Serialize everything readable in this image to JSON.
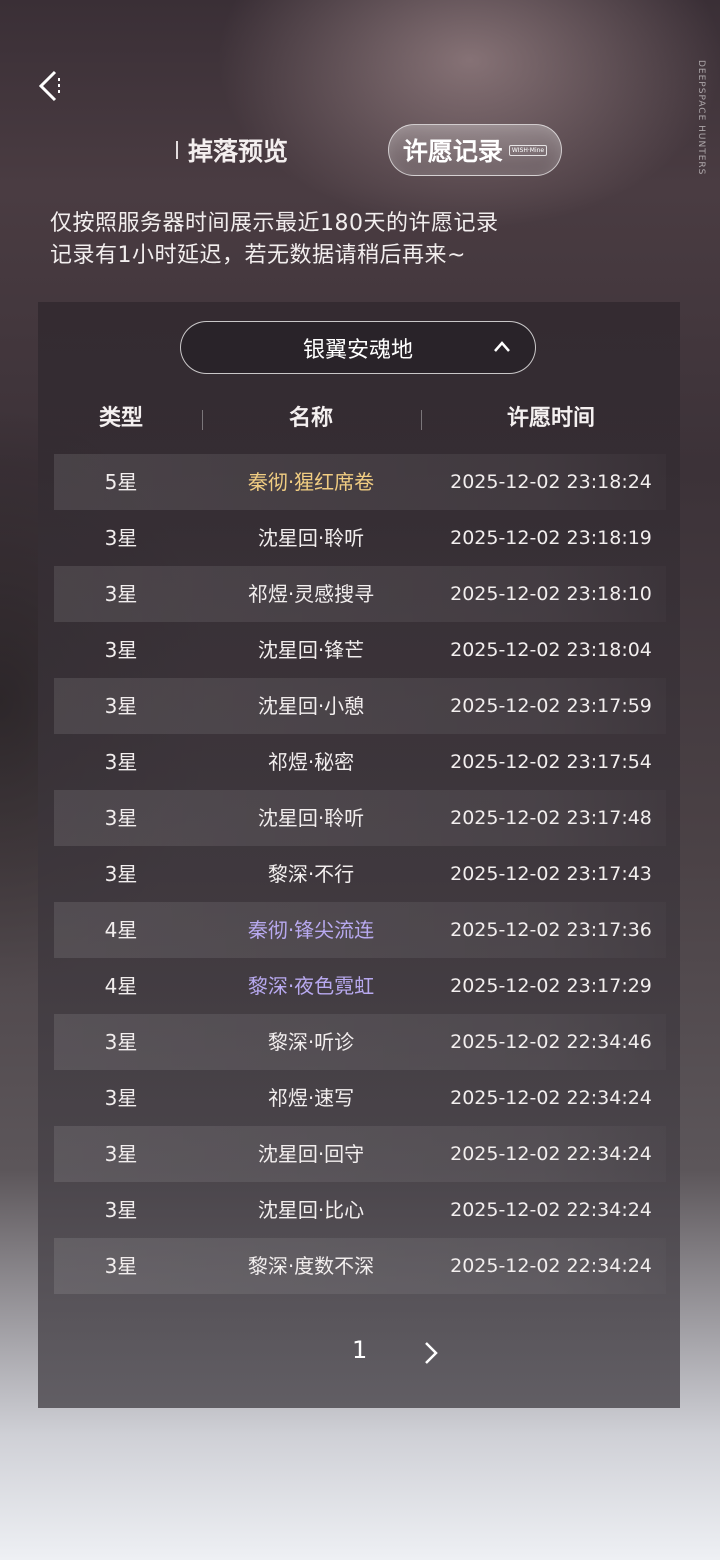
{
  "header": {
    "back_icon": "back-chevron-icon",
    "brand_text": "DEEPSPACE HUNTERS"
  },
  "tabs": [
    {
      "label": "掉落预览",
      "active": false
    },
    {
      "label": "许愿记录",
      "active": true,
      "mini_tag": "WISH·Mine"
    }
  ],
  "notice": {
    "line1": "仅按照服务器时间展示最近180天的许愿记录",
    "line2": "记录有1小时延迟，若无数据请稍后再来~"
  },
  "pool_select": {
    "value": "银翼安魂地",
    "icon": "chevron-up-icon"
  },
  "table": {
    "headers": [
      "类型",
      "名称",
      "许愿时间"
    ],
    "rows": [
      {
        "type": "5星",
        "name": "秦彻·猩红席卷",
        "time": "2025-12-02 23:18:24",
        "rarity": 5
      },
      {
        "type": "3星",
        "name": "沈星回·聆听",
        "time": "2025-12-02 23:18:19",
        "rarity": 3
      },
      {
        "type": "3星",
        "name": "祁煜·灵感搜寻",
        "time": "2025-12-02 23:18:10",
        "rarity": 3
      },
      {
        "type": "3星",
        "name": "沈星回·锋芒",
        "time": "2025-12-02 23:18:04",
        "rarity": 3
      },
      {
        "type": "3星",
        "name": "沈星回·小憩",
        "time": "2025-12-02 23:17:59",
        "rarity": 3
      },
      {
        "type": "3星",
        "name": "祁煜·秘密",
        "time": "2025-12-02 23:17:54",
        "rarity": 3
      },
      {
        "type": "3星",
        "name": "沈星回·聆听",
        "time": "2025-12-02 23:17:48",
        "rarity": 3
      },
      {
        "type": "3星",
        "name": "黎深·不行",
        "time": "2025-12-02 23:17:43",
        "rarity": 3
      },
      {
        "type": "4星",
        "name": "秦彻·锋尖流连",
        "time": "2025-12-02 23:17:36",
        "rarity": 4
      },
      {
        "type": "4星",
        "name": "黎深·夜色霓虹",
        "time": "2025-12-02 23:17:29",
        "rarity": 4
      },
      {
        "type": "3星",
        "name": "黎深·听诊",
        "time": "2025-12-02 22:34:46",
        "rarity": 3
      },
      {
        "type": "3星",
        "name": "祁煜·速写",
        "time": "2025-12-02 22:34:24",
        "rarity": 3
      },
      {
        "type": "3星",
        "name": "沈星回·回守",
        "time": "2025-12-02 22:34:24",
        "rarity": 3
      },
      {
        "type": "3星",
        "name": "沈星回·比心",
        "time": "2025-12-02 22:34:24",
        "rarity": 3
      },
      {
        "type": "3星",
        "name": "黎深·度数不深",
        "time": "2025-12-02 22:34:24",
        "rarity": 3
      }
    ]
  },
  "pagination": {
    "current_page": "1",
    "next_icon": "chevron-right-icon"
  },
  "colors": {
    "rarity_5": "#f1cd82",
    "rarity_4": "#b8a9ef",
    "rarity_3": "#f2eeee"
  }
}
